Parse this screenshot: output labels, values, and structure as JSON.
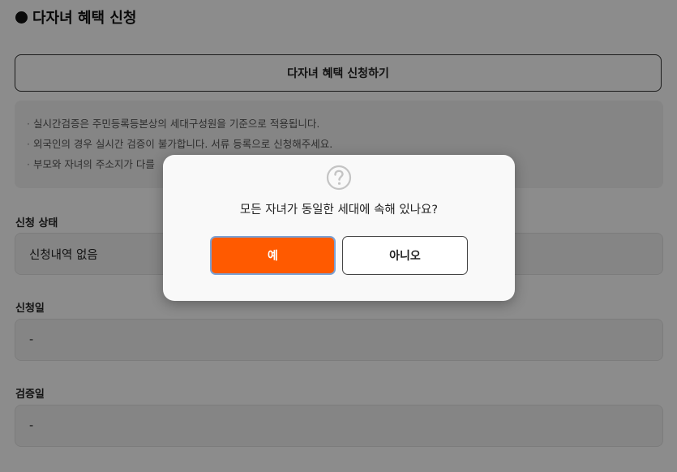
{
  "page": {
    "section_title": "다자녀 혜택 신청",
    "apply_button_label": "다자녀 혜택 신청하기",
    "notices": [
      "실시간검증은 주민등록등본상의 세대구성원을 기준으로 적용됩니다.",
      "외국인의 경우 실시간 검증이 불가합니다. 서류 등록으로 신청해주세요.",
      "부모와 자녀의 주소지가 다를"
    ],
    "fields": [
      {
        "label": "신청 상태",
        "value": "신청내역 없음"
      },
      {
        "label": "신청일",
        "value": "-"
      },
      {
        "label": "검증일",
        "value": "-"
      }
    ]
  },
  "modal": {
    "icon": "question-circle-icon",
    "message": "모든 자녀가 동일한 세대에 속해 있나요?",
    "yes_label": "예",
    "no_label": "아니오"
  },
  "colors": {
    "accent": "#ff5a00",
    "overlay": "rgba(0,0,0,0.45)"
  }
}
